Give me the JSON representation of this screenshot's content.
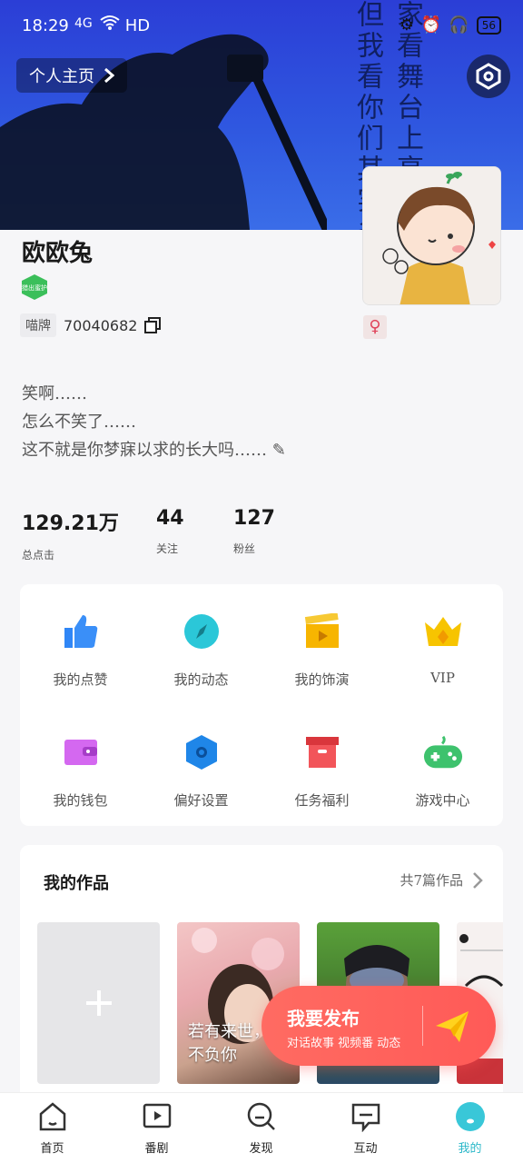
{
  "status_bar": {
    "time": "18:29",
    "signal": "4G",
    "network": "HD",
    "battery": "56"
  },
  "banner": {
    "lyrics": [
      "家看舞台上亮",
      "但我看你们其实多"
    ],
    "profile_home_label": "个人主页"
  },
  "profile": {
    "username": "欧欧兔",
    "badge_text": "猎出蜜护",
    "id_tag": "喵牌",
    "id_number": "70040682",
    "gender_symbol": "♀",
    "bio_lines": [
      "笑啊……",
      "怎么不笑了……",
      "这不就是你梦寐以求的长大吗……"
    ]
  },
  "stats": [
    {
      "value": "129.21万",
      "label": "总点击"
    },
    {
      "value": "44",
      "label": "关注"
    },
    {
      "value": "127",
      "label": "粉丝"
    }
  ],
  "grid": [
    {
      "label": "我的点赞",
      "icon": "thumbs-up-icon",
      "color": "#2f86f6"
    },
    {
      "label": "我的动态",
      "icon": "compass-icon",
      "color": "#2bc7d8"
    },
    {
      "label": "我的饰演",
      "icon": "clapperboard-icon",
      "color": "#f7b500"
    },
    {
      "label": "VIP",
      "icon": "crown-icon",
      "color": "#f7c400"
    },
    {
      "label": "我的钱包",
      "icon": "wallet-icon",
      "color": "#d468f0"
    },
    {
      "label": "偏好设置",
      "icon": "hexagon-settings-icon",
      "color": "#1f86e8"
    },
    {
      "label": "任务福利",
      "icon": "gift-box-icon",
      "color": "#f2555a"
    },
    {
      "label": "游戏中心",
      "icon": "gamepad-icon",
      "color": "#3ec26d"
    }
  ],
  "works": {
    "title": "我的作品",
    "count_label": "共7篇作品",
    "items": [
      {
        "caption": "若有来世，\n不负你"
      }
    ]
  },
  "publish": {
    "title": "我要发布",
    "subtitle": "对话故事 视频番 动态"
  },
  "nav": [
    {
      "label": "首页",
      "icon": "home-icon"
    },
    {
      "label": "番剧",
      "icon": "play-video-icon"
    },
    {
      "label": "发现",
      "icon": "search-discover-icon"
    },
    {
      "label": "互动",
      "icon": "chat-icon"
    },
    {
      "label": "我的",
      "icon": "profile-icon",
      "active": true
    }
  ]
}
